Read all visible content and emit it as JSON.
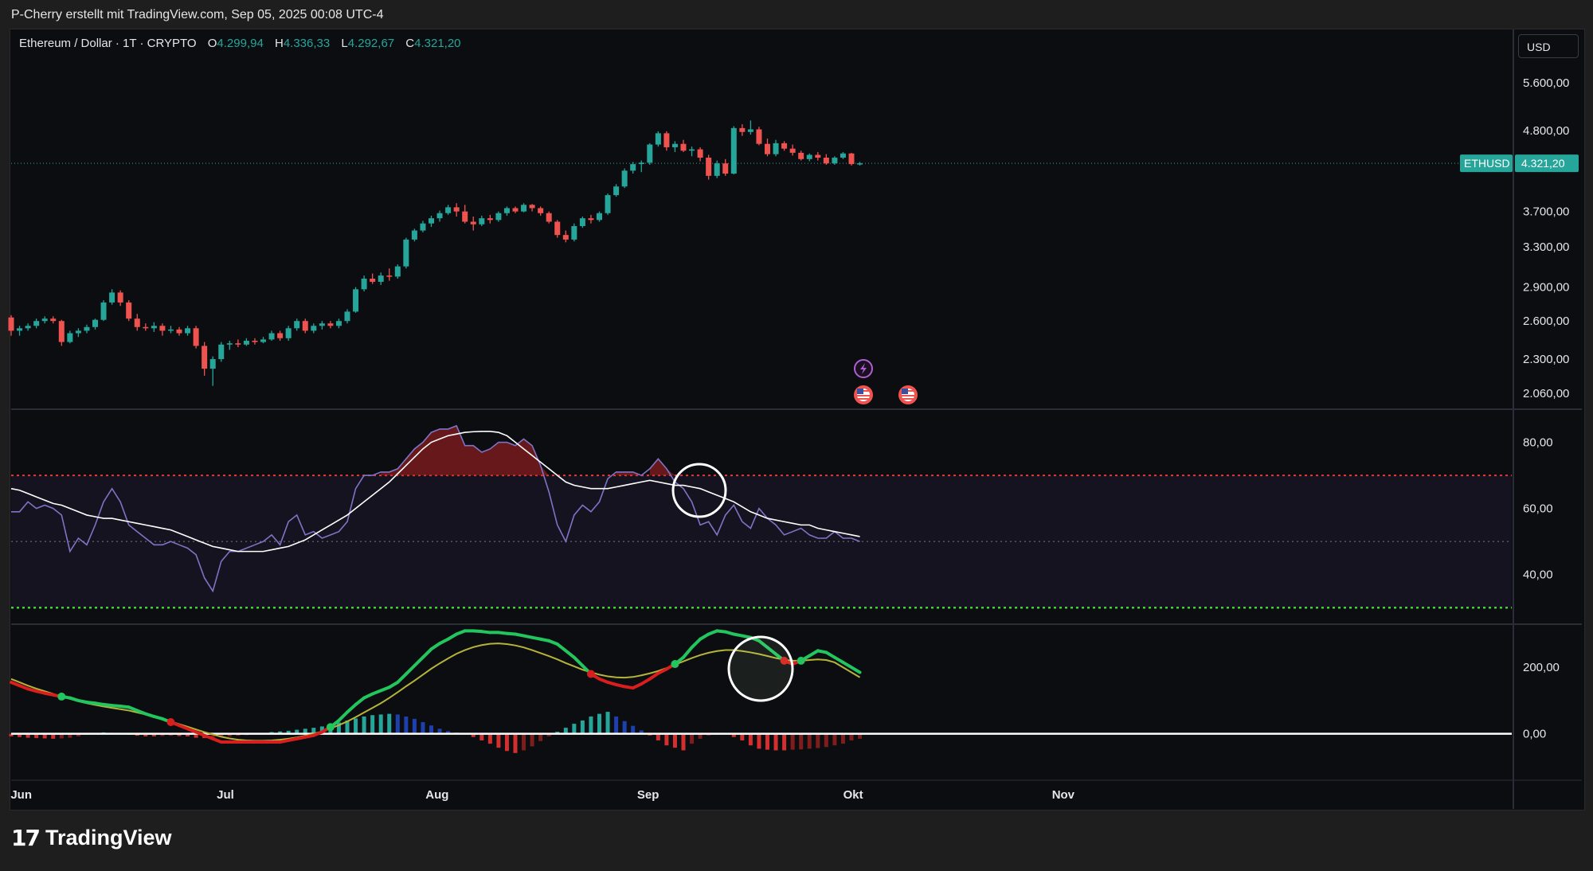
{
  "header": {
    "credit": "P-Cherry erstellt mit TradingView.com, Sep 05, 2025 00:08 UTC-4"
  },
  "legend": {
    "symbol": "Ethereum / Dollar · 1T · CRYPTO",
    "o_label": "O",
    "o": "4.299,94",
    "h_label": "H",
    "h": "4.336,33",
    "l_label": "L",
    "l": "4.292,67",
    "c_label": "C",
    "c": "4.321,20"
  },
  "currency": "USD",
  "price_tag": {
    "symbol": "ETHUSD",
    "value": "4.321,20"
  },
  "brand": "TradingView",
  "colors": {
    "up": "#26a69a",
    "down": "#ef5350",
    "bg": "#0c0d10",
    "rsi_line": "#7e74c6",
    "rsi_ma": "#ffffff",
    "overbought": "#e53935",
    "oversold": "#43d13a",
    "macd_up": "#22c55e",
    "macd_down": "#d91e1e",
    "signal": "#b4b43a"
  },
  "chart_data": [
    {
      "type": "candlestick",
      "title": "Ethereum / Dollar · 1T · CRYPTO",
      "scale": "log",
      "y_ticks": [
        "5.600,00",
        "4.800,00",
        "3.700,00",
        "3.300,00",
        "2.900,00",
        "2.600,00",
        "2.300,00",
        "2.060,00"
      ],
      "x_ticks": [
        "Jun",
        "Jul",
        "Aug",
        "Sep",
        "Okt",
        "Nov"
      ],
      "last_price": 4321.2,
      "event_icons": [
        "lightning-icon",
        "us-flag-icon",
        "us-flag-icon"
      ],
      "candles": [
        [
          2630,
          2650,
          2480,
          2520
        ],
        [
          2520,
          2560,
          2480,
          2540
        ],
        [
          2540,
          2580,
          2520,
          2560
        ],
        [
          2560,
          2620,
          2540,
          2600
        ],
        [
          2600,
          2640,
          2580,
          2620
        ],
        [
          2620,
          2640,
          2580,
          2600
        ],
        [
          2600,
          2610,
          2400,
          2430
        ],
        [
          2430,
          2520,
          2420,
          2500
        ],
        [
          2500,
          2540,
          2470,
          2520
        ],
        [
          2520,
          2570,
          2500,
          2550
        ],
        [
          2550,
          2620,
          2530,
          2610
        ],
        [
          2610,
          2780,
          2600,
          2760
        ],
        [
          2760,
          2880,
          2740,
          2850
        ],
        [
          2850,
          2870,
          2730,
          2760
        ],
        [
          2760,
          2780,
          2600,
          2620
        ],
        [
          2620,
          2660,
          2520,
          2550
        ],
        [
          2550,
          2580,
          2520,
          2540
        ],
        [
          2540,
          2590,
          2510,
          2560
        ],
        [
          2560,
          2580,
          2480,
          2520
        ],
        [
          2520,
          2560,
          2500,
          2530
        ],
        [
          2530,
          2550,
          2480,
          2500
        ],
        [
          2500,
          2560,
          2480,
          2540
        ],
        [
          2540,
          2560,
          2380,
          2400
        ],
        [
          2400,
          2430,
          2180,
          2230
        ],
        [
          2230,
          2320,
          2110,
          2300
        ],
        [
          2300,
          2430,
          2280,
          2410
        ],
        [
          2410,
          2440,
          2370,
          2420
        ],
        [
          2420,
          2450,
          2390,
          2410
        ],
        [
          2410,
          2460,
          2400,
          2440
        ],
        [
          2440,
          2460,
          2410,
          2430
        ],
        [
          2430,
          2470,
          2420,
          2450
        ],
        [
          2450,
          2520,
          2440,
          2500
        ],
        [
          2500,
          2520,
          2440,
          2460
        ],
        [
          2460,
          2560,
          2440,
          2540
        ],
        [
          2540,
          2620,
          2520,
          2600
        ],
        [
          2600,
          2620,
          2500,
          2520
        ],
        [
          2520,
          2580,
          2500,
          2560
        ],
        [
          2560,
          2600,
          2530,
          2580
        ],
        [
          2580,
          2600,
          2540,
          2560
        ],
        [
          2560,
          2620,
          2540,
          2600
        ],
        [
          2600,
          2700,
          2580,
          2680
        ],
        [
          2680,
          2900,
          2670,
          2880
        ],
        [
          2880,
          3010,
          2860,
          2980
        ],
        [
          2980,
          3030,
          2930,
          2950
        ],
        [
          2950,
          3040,
          2920,
          3010
        ],
        [
          3010,
          3080,
          2960,
          3000
        ],
        [
          3000,
          3120,
          2980,
          3100
        ],
        [
          3100,
          3400,
          3080,
          3380
        ],
        [
          3380,
          3500,
          3360,
          3480
        ],
        [
          3480,
          3590,
          3460,
          3560
        ],
        [
          3560,
          3650,
          3520,
          3620
        ],
        [
          3620,
          3710,
          3580,
          3680
        ],
        [
          3680,
          3780,
          3660,
          3750
        ],
        [
          3750,
          3800,
          3640,
          3700
        ],
        [
          3700,
          3780,
          3560,
          3580
        ],
        [
          3580,
          3640,
          3480,
          3550
        ],
        [
          3550,
          3650,
          3530,
          3620
        ],
        [
          3620,
          3660,
          3560,
          3600
        ],
        [
          3600,
          3700,
          3580,
          3680
        ],
        [
          3680,
          3760,
          3650,
          3740
        ],
        [
          3740,
          3760,
          3680,
          3700
        ],
        [
          3700,
          3800,
          3690,
          3780
        ],
        [
          3780,
          3790,
          3700,
          3740
        ],
        [
          3740,
          3760,
          3650,
          3680
        ],
        [
          3680,
          3700,
          3560,
          3580
        ],
        [
          3580,
          3600,
          3400,
          3430
        ],
        [
          3430,
          3480,
          3350,
          3380
        ],
        [
          3380,
          3560,
          3360,
          3530
        ],
        [
          3530,
          3640,
          3510,
          3620
        ],
        [
          3620,
          3660,
          3560,
          3600
        ],
        [
          3600,
          3700,
          3580,
          3680
        ],
        [
          3680,
          3920,
          3660,
          3900
        ],
        [
          3900,
          4040,
          3880,
          4010
        ],
        [
          4010,
          4250,
          3990,
          4220
        ],
        [
          4220,
          4340,
          4180,
          4310
        ],
        [
          4310,
          4360,
          4200,
          4330
        ],
        [
          4330,
          4610,
          4300,
          4590
        ],
        [
          4590,
          4790,
          4560,
          4760
        ],
        [
          4760,
          4790,
          4500,
          4550
        ],
        [
          4550,
          4640,
          4480,
          4600
        ],
        [
          4600,
          4660,
          4480,
          4500
        ],
        [
          4500,
          4560,
          4420,
          4520
        ],
        [
          4520,
          4550,
          4350,
          4400
        ],
        [
          4400,
          4440,
          4100,
          4150
        ],
        [
          4150,
          4360,
          4120,
          4320
        ],
        [
          4320,
          4380,
          4150,
          4180
        ],
        [
          4180,
          4870,
          4170,
          4840
        ],
        [
          4840,
          4900,
          4720,
          4780
        ],
        [
          4780,
          4960,
          4740,
          4820
        ],
        [
          4820,
          4860,
          4580,
          4600
        ],
        [
          4600,
          4680,
          4420,
          4450
        ],
        [
          4450,
          4660,
          4420,
          4610
        ],
        [
          4610,
          4640,
          4500,
          4530
        ],
        [
          4530,
          4590,
          4430,
          4470
        ],
        [
          4470,
          4500,
          4360,
          4380
        ],
        [
          4380,
          4460,
          4350,
          4440
        ],
        [
          4440,
          4480,
          4360,
          4400
        ],
        [
          4400,
          4450,
          4300,
          4320
        ],
        [
          4320,
          4420,
          4300,
          4400
        ],
        [
          4400,
          4480,
          4380,
          4460
        ],
        [
          4460,
          4470,
          4290,
          4310
        ],
        [
          4310,
          4340,
          4290,
          4321.2
        ]
      ]
    },
    {
      "type": "line",
      "title": "RSI",
      "y_ticks": [
        "80,00",
        "60,00",
        "40,00"
      ],
      "ylim": [
        25,
        90
      ],
      "levels": [
        70,
        50,
        30
      ],
      "series": [
        {
          "values": [
            59,
            59,
            62,
            60,
            61,
            60,
            58,
            47,
            51,
            49,
            55,
            62,
            66,
            62,
            55,
            53,
            51,
            49,
            49,
            50,
            49,
            48,
            46,
            39,
            35,
            44,
            47,
            47,
            48,
            49,
            50,
            52,
            49,
            56,
            58,
            52,
            53,
            51,
            52,
            53,
            56,
            66,
            70,
            70,
            71,
            71,
            72,
            75,
            78,
            80,
            83,
            84,
            84,
            85,
            79,
            79,
            77,
            78,
            80,
            80,
            79,
            81,
            79,
            73,
            65,
            55,
            50,
            58,
            61,
            59,
            62,
            69,
            71,
            71,
            71,
            70,
            72,
            75,
            72,
            68,
            66,
            62,
            55,
            56,
            52,
            58,
            61,
            56,
            54,
            60,
            57,
            55,
            52,
            53,
            54,
            52,
            51,
            51,
            53,
            51,
            51,
            50
          ]
        },
        {
          "values": [
            66,
            65.5,
            64.5,
            63.5,
            62.5,
            61.5,
            61,
            60,
            59,
            58,
            57.5,
            57,
            57,
            56.5,
            56,
            55.5,
            55,
            54.5,
            54,
            53.5,
            52.5,
            51.5,
            50.5,
            49.5,
            48.5,
            48,
            47.5,
            47,
            47,
            47,
            47,
            47.5,
            48,
            48.5,
            49.5,
            50.5,
            52,
            53.5,
            55,
            56.5,
            58,
            60,
            62,
            64,
            66,
            68,
            70.5,
            73,
            75.5,
            78,
            80,
            81,
            82,
            82.5,
            83,
            83.2,
            83.3,
            83.3,
            83,
            82,
            80,
            78,
            76,
            74,
            72,
            70,
            68,
            67,
            66.5,
            66,
            66,
            66,
            66.5,
            67,
            67.5,
            68,
            68.5,
            68,
            67.5,
            67,
            67,
            66.5,
            66,
            65,
            64,
            63,
            62,
            60.5,
            59,
            58,
            57,
            56.5,
            56,
            55.5,
            55,
            55,
            54,
            53.5,
            53,
            52.5,
            52,
            51.5
          ]
        }
      ]
    },
    {
      "type": "line",
      "title": "MACD",
      "y_ticks": [
        "200,00",
        "0,00"
      ],
      "ylim": [
        -140,
        330
      ],
      "series": [
        {
          "values": [
            155,
            145,
            135,
            128,
            122,
            117,
            112,
            108,
            100,
            95,
            92,
            88,
            85,
            83,
            80,
            70,
            60,
            52,
            45,
            35,
            25,
            15,
            5,
            -5,
            -15,
            -25,
            -25,
            -25,
            -25,
            -25,
            -25,
            -25,
            -25,
            -20,
            -15,
            -10,
            -5,
            5,
            20,
            40,
            65,
            88,
            108,
            120,
            130,
            140,
            155,
            180,
            205,
            230,
            255,
            272,
            285,
            300,
            310,
            310,
            308,
            305,
            305,
            302,
            300,
            295,
            290,
            285,
            280,
            270,
            250,
            230,
            205,
            180,
            165,
            155,
            148,
            142,
            138,
            150,
            165,
            182,
            195,
            210,
            230,
            260,
            285,
            300,
            310,
            307,
            300,
            295,
            290,
            280,
            260,
            240,
            220,
            210,
            220,
            235,
            250,
            245,
            230,
            215,
            200,
            185
          ]
        },
        {
          "values": [
            165,
            155,
            145,
            136,
            128,
            120,
            112,
            105,
            98,
            92,
            87,
            82,
            78,
            74,
            70,
            64,
            58,
            51,
            44,
            37,
            29,
            21,
            13,
            5,
            -2,
            -9,
            -14,
            -18,
            -20,
            -21,
            -21,
            -20,
            -18,
            -15,
            -11,
            -6,
            0,
            7,
            16,
            26,
            37,
            50,
            64,
            78,
            92,
            108,
            125,
            143,
            160,
            178,
            196,
            212,
            227,
            241,
            252,
            261,
            267,
            271,
            272,
            270,
            266,
            260,
            252,
            243,
            234,
            224,
            213,
            203,
            193,
            185,
            178,
            173,
            170,
            169,
            171,
            176,
            182,
            189,
            198,
            208,
            218,
            228,
            237,
            244,
            249,
            252,
            252,
            249,
            245,
            240,
            234,
            228,
            223,
            220,
            220,
            222,
            224,
            222,
            215,
            200,
            185,
            170
          ]
        },
        {
          "values": [
            -8,
            -10,
            -12,
            -13,
            -14,
            -15,
            -14,
            -12,
            -8,
            -3,
            2,
            4,
            3,
            1,
            -3,
            -6,
            -8,
            -8,
            -7,
            -6,
            -7,
            -8,
            -12,
            -13,
            -12,
            -10,
            -8,
            -6,
            -4,
            -1,
            2,
            5,
            7,
            9,
            12,
            15,
            18,
            22,
            28,
            34,
            40,
            46,
            52,
            56,
            58,
            60,
            58,
            52,
            45,
            35,
            25,
            15,
            8,
            4,
            -2,
            -10,
            -20,
            -30,
            -42,
            -52,
            -58,
            -50,
            -38,
            -22,
            -8,
            6,
            18,
            30,
            40,
            52,
            60,
            66,
            52,
            38,
            24,
            10,
            -5,
            -20,
            -35,
            -42,
            -50,
            -30,
            -15,
            -5,
            -3,
            -2,
            -10,
            -20,
            -35,
            -45,
            -48,
            -50,
            -50,
            -48,
            -47,
            -45,
            -43,
            -40,
            -35,
            -30,
            -20,
            -15
          ]
        }
      ]
    }
  ]
}
